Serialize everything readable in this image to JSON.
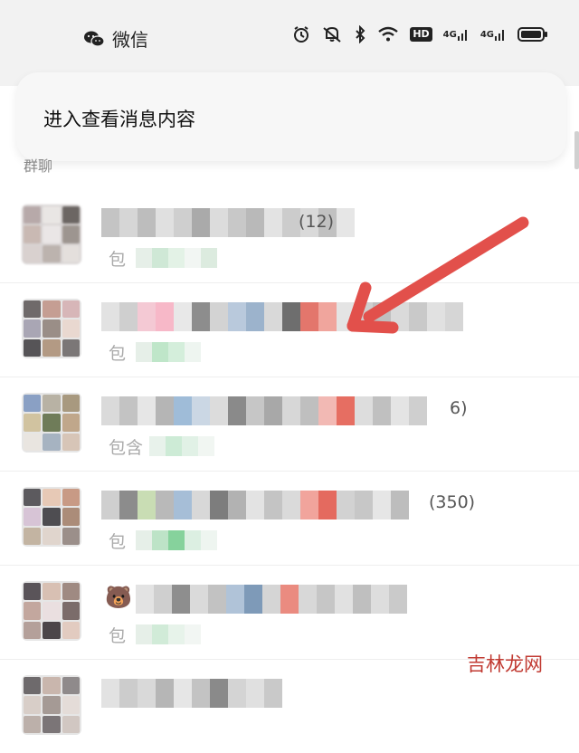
{
  "status_bar": {
    "app_name": "微信",
    "hd_label": "HD",
    "net1_label": "4G",
    "net2_label": "4G"
  },
  "notification": {
    "text": "进入查看消息内容"
  },
  "section": {
    "title": "群聊"
  },
  "rows": [
    {
      "subtitle_prefix": "包",
      "title_tail": "(12)"
    },
    {
      "subtitle_prefix": "包",
      "title_tail": ""
    },
    {
      "subtitle_prefix": "包含",
      "title_tail": "6)"
    },
    {
      "subtitle_prefix": "包",
      "title_tail": "(350)"
    },
    {
      "subtitle_prefix": "包",
      "title_tail": ""
    },
    {
      "subtitle_prefix": "",
      "title_tail": ""
    }
  ],
  "colors": {
    "arrow": "#e2504b",
    "watermark": "#c13a32"
  },
  "watermark": "吉林龙网"
}
